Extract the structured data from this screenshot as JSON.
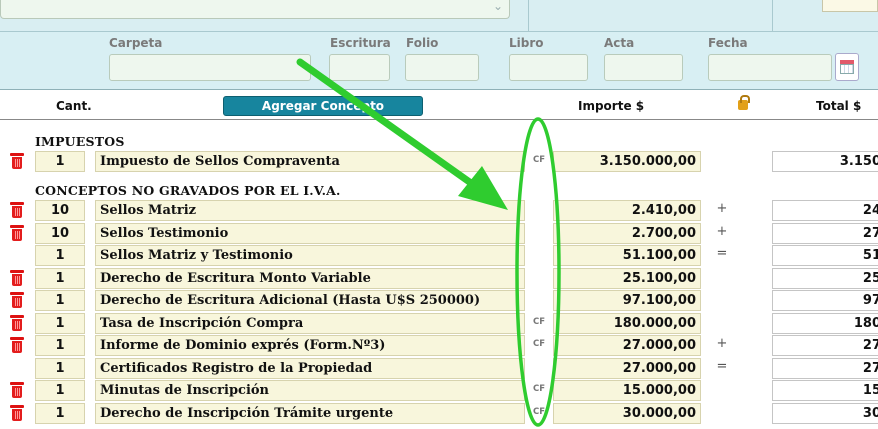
{
  "form": {
    "labels": {
      "carpeta": "Carpeta",
      "escritura": "Escritura",
      "folio": "Folio",
      "libro": "Libro",
      "acta": "Acta",
      "fecha": "Fecha"
    }
  },
  "table": {
    "headers": {
      "cant": "Cant.",
      "add_button": "Agregar Concepto",
      "importe": "Importe $",
      "total": "Total $"
    },
    "sections": {
      "impuestos": "IMPUESTOS",
      "no_gravados": "CONCEPTOS NO GRAVADOS POR EL I.V.A."
    },
    "rows": [
      {
        "qty": "1",
        "desc": "Impuesto de Sellos Compraventa",
        "cf": "CF",
        "importe": "3.150.000,00",
        "op": "",
        "total": "3.150",
        "deletable": true
      },
      {
        "qty": "10",
        "desc": "Sellos Matriz",
        "cf": "",
        "importe": "2.410,00",
        "op": "+",
        "total": "24",
        "deletable": true
      },
      {
        "qty": "10",
        "desc": "Sellos Testimonio",
        "cf": "",
        "importe": "2.700,00",
        "op": "+",
        "total": "27",
        "deletable": true
      },
      {
        "qty": "1",
        "desc": "Sellos Matriz y Testimonio",
        "cf": "",
        "importe": "51.100,00",
        "op": "=",
        "total": "51",
        "deletable": false
      },
      {
        "qty": "1",
        "desc": "Derecho de Escritura Monto Variable",
        "cf": "",
        "importe": "25.100,00",
        "op": "",
        "total": "25",
        "deletable": true
      },
      {
        "qty": "1",
        "desc": "Derecho de Escritura Adicional (Hasta U$S 250000)",
        "cf": "",
        "importe": "97.100,00",
        "op": "",
        "total": "97",
        "deletable": true
      },
      {
        "qty": "1",
        "desc": "Tasa de Inscripción Compra",
        "cf": "CF",
        "importe": "180.000,00",
        "op": "",
        "total": "180",
        "deletable": true
      },
      {
        "qty": "1",
        "desc": "Informe de Dominio exprés (Form.Nº3)",
        "cf": "CF",
        "importe": "27.000,00",
        "op": "+",
        "total": "27",
        "deletable": true
      },
      {
        "qty": "1",
        "desc": "Certificados Registro de la Propiedad",
        "cf": "",
        "importe": "27.000,00",
        "op": "=",
        "total": "27",
        "deletable": false
      },
      {
        "qty": "1",
        "desc": "Minutas de Inscripción",
        "cf": "CF",
        "importe": "15.000,00",
        "op": "",
        "total": "15",
        "deletable": true
      },
      {
        "qty": "1",
        "desc": "Derecho de Inscripción Trámite urgente",
        "cf": "CF",
        "importe": "30.000,00",
        "op": "",
        "total": "30",
        "deletable": true
      }
    ]
  },
  "annotation": {
    "color": "#2fcc2f"
  }
}
